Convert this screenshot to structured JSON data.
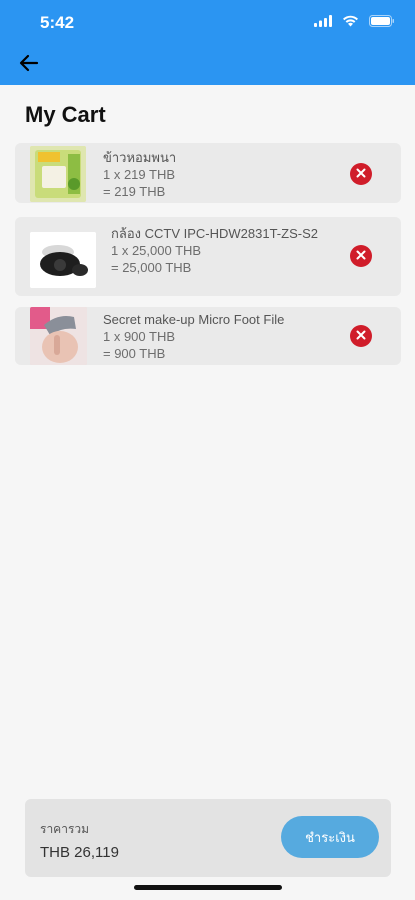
{
  "status_bar": {
    "time": "5:42"
  },
  "title": "My Cart",
  "items": [
    {
      "name": "ข้าวหอมพนา",
      "quantity_line": "1 x 219 THB",
      "total_line": "= 219 THB",
      "image": "rice-bag-photo"
    },
    {
      "name": "กล้อง CCTV IPC-HDW2831T-ZS-S2",
      "quantity_line": "1 x 25,000 THB",
      "total_line": "= 25,000 THB",
      "image": "cctv-camera-photo"
    },
    {
      "name": "Secret make-up Micro Foot File",
      "quantity_line": "1 x 900 THB",
      "total_line": "= 900 THB",
      "image": "foot-file-photo"
    }
  ],
  "summary": {
    "total_label": "ราคารวม",
    "total_value": "THB 26,119",
    "pay_label": "ชำระเงิน"
  },
  "colors": {
    "appbar": "#2b95f2",
    "remove": "#d01d2a",
    "pay_button": "#56aadf"
  }
}
